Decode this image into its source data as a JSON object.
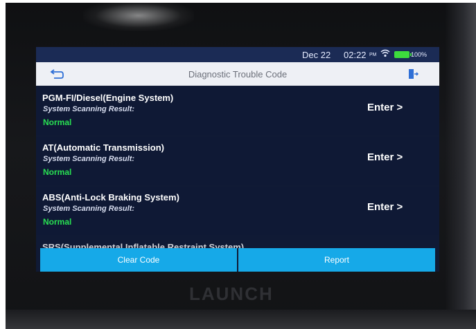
{
  "status": {
    "date": "Dec 22",
    "time": "02:22",
    "ampm": "PM",
    "wifi_icon": "wifi-icon",
    "battery_label": "100%",
    "battery_color": "#3ddc3d"
  },
  "header": {
    "title": "Diagnostic Trouble Code",
    "back_icon": "back-arrow-icon",
    "exit_icon": "exit-icon"
  },
  "systems": [
    {
      "name": "PGM-FI/Diesel(Engine System)",
      "sub_label": "System Scanning Result:",
      "result": "Normal",
      "enter_label": "Enter >"
    },
    {
      "name": "AT(Automatic Transmission)",
      "sub_label": "System Scanning Result:",
      "result": "Normal",
      "enter_label": "Enter >"
    },
    {
      "name": "ABS(Anti-Lock Braking System)",
      "sub_label": "System Scanning Result:",
      "result": "Normal",
      "enter_label": "Enter >"
    }
  ],
  "partial_system": "SRS(Supplemental Inflatable Restraint System)",
  "buttons": {
    "clear": "Clear Code",
    "report": "Report"
  },
  "device_brand": "LAUNCH",
  "colors": {
    "accent": "#16a9e8",
    "normal_status": "#28e052"
  }
}
